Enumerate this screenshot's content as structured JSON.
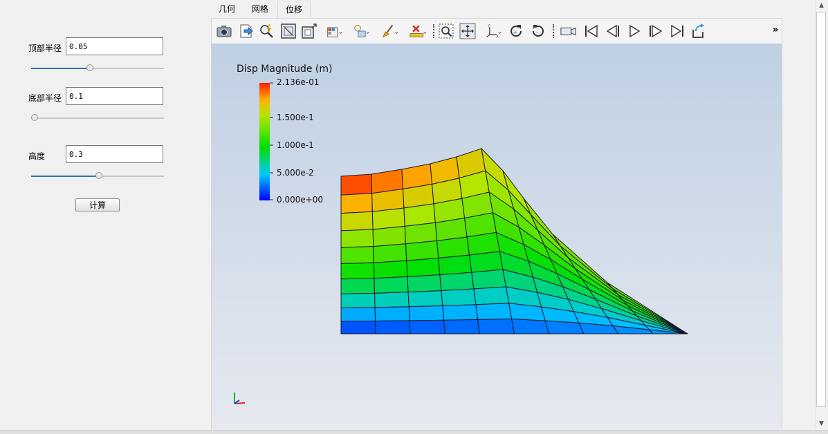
{
  "params": [
    {
      "label": "顶部半径",
      "value": "0.05",
      "slider_fraction": 0.44
    },
    {
      "label": "底部半径",
      "value": "0.1",
      "slider_fraction": 0.0
    },
    {
      "label": "高度",
      "value": "0.3",
      "slider_fraction": 0.51
    }
  ],
  "calc_button": "计算",
  "tabs": [
    "几何",
    "网格",
    "位移"
  ],
  "active_tab": 2,
  "toolbar": {
    "icons": [
      "camera-icon",
      "export-icon",
      "zoom-to-data-icon",
      "reset-camera-frame-icon",
      "zoom-closest-icon",
      "render-view-options-icon",
      "light-icon",
      "annotation-brush-icon",
      "ruler-delete-icon",
      "zoom-to-box-icon",
      "pan-center-icon",
      "axes-icon",
      "rotate-cw-icon",
      "rotate-ccw-icon",
      "video-camera-icon",
      "first-frame-icon",
      "prev-frame-icon",
      "play-icon",
      "next-frame-icon",
      "last-frame-icon",
      "loop-icon"
    ],
    "overflow": "»"
  },
  "legend": {
    "title": "Disp Magnitude (m)",
    "labels": [
      "2.136e-01",
      "1.500e-1",
      "1.000e-1",
      "5.000e-2",
      "0.000e+00"
    ]
  },
  "colors": {
    "accent": "#2f6fb3",
    "mesh_line": "#1a1a2e"
  }
}
